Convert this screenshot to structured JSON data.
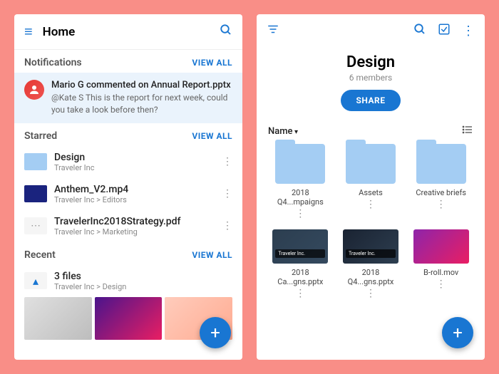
{
  "left": {
    "title": "Home",
    "notifications": {
      "header": "Notifications",
      "view_all": "VIEW ALL",
      "item": {
        "title": "Mario G commented on Annual Report.pptx",
        "text": "@Kate S This is the report for next week, could you take a look before then?"
      }
    },
    "starred": {
      "header": "Starred",
      "view_all": "VIEW ALL",
      "items": [
        {
          "name": "Design",
          "path": "Traveler Inc"
        },
        {
          "name": "Anthem_V2.mp4",
          "path": "Traveler Inc > Editors"
        },
        {
          "name": "TravelerInc2018Strategy.pdf",
          "path": "Traveler Inc > Marketing"
        }
      ]
    },
    "recent": {
      "header": "Recent",
      "view_all": "VIEW ALL",
      "item": {
        "name": "3 files",
        "path": "Traveler Inc > Design"
      }
    }
  },
  "right": {
    "title": "Design",
    "members": "6 members",
    "share": "SHARE",
    "sort": "Name",
    "folders": [
      "2018 Q4...mpaigns",
      "Assets",
      "Creative briefs"
    ],
    "files": [
      {
        "name": "2018 Ca...gns.pptx",
        "banner": "Traveler Inc."
      },
      {
        "name": "2018 Q4...gns.pptx",
        "banner": "Traveler Inc."
      },
      {
        "name": "B-roll.mov",
        "banner": ""
      }
    ]
  }
}
